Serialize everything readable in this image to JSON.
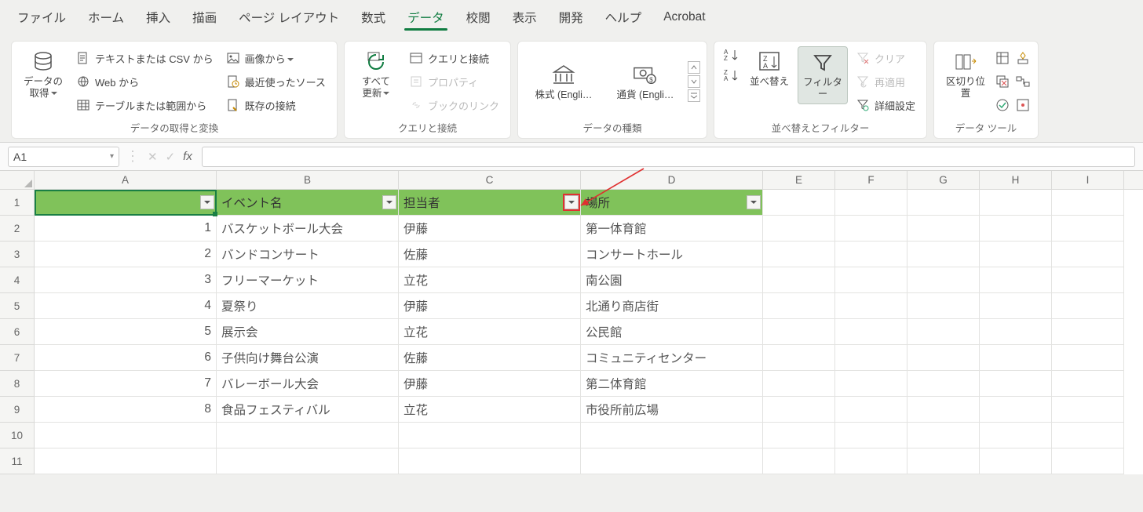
{
  "menu": [
    "ファイル",
    "ホーム",
    "挿入",
    "描画",
    "ページ レイアウト",
    "数式",
    "データ",
    "校閲",
    "表示",
    "開発",
    "ヘルプ",
    "Acrobat"
  ],
  "menu_active_index": 6,
  "ribbon": {
    "get_data": {
      "big": "データの\n取得",
      "items": [
        "テキストまたは CSV から",
        "Web から",
        "テーブルまたは範囲から"
      ],
      "col2": [
        "画像から",
        "最近使ったソース",
        "既存の接続"
      ],
      "label": "データの取得と変換"
    },
    "queries": {
      "big": "すべて\n更新",
      "items": [
        "クエリと接続",
        "プロパティ",
        "ブックのリンク"
      ],
      "label": "クエリと接続"
    },
    "datatypes": {
      "stock": "株式 (Engli…",
      "currency": "通貨 (Engli…",
      "label": "データの種類"
    },
    "sort": {
      "sort_btn": "並べ替え",
      "filter_btn": "フィルター",
      "clear": "クリア",
      "reapply": "再適用",
      "advanced": "詳細設定",
      "label": "並べ替えとフィルター"
    },
    "tools": {
      "t2c": "区切り位置",
      "label": "データ ツール"
    }
  },
  "namebox": "A1",
  "columns": [
    "A",
    "B",
    "C",
    "D",
    "E",
    "F",
    "G",
    "H",
    "I"
  ],
  "rows": [
    1,
    2,
    3,
    4,
    5,
    6,
    7,
    8,
    9,
    10,
    11
  ],
  "headers": {
    "A": "",
    "B": "イベント名",
    "C": "担当者",
    "D": "場所"
  },
  "data": [
    {
      "A": "1",
      "B": "バスケットボール大会",
      "C": "伊藤",
      "D": "第一体育館"
    },
    {
      "A": "2",
      "B": "バンドコンサート",
      "C": "佐藤",
      "D": "コンサートホール"
    },
    {
      "A": "3",
      "B": "フリーマーケット",
      "C": "立花",
      "D": "南公園"
    },
    {
      "A": "4",
      "B": "夏祭り",
      "C": "伊藤",
      "D": "北通り商店街"
    },
    {
      "A": "5",
      "B": "展示会",
      "C": "立花",
      "D": "公民館"
    },
    {
      "A": "6",
      "B": "子供向け舞台公演",
      "C": "佐藤",
      "D": "コミュニティセンター"
    },
    {
      "A": "7",
      "B": "バレーボール大会",
      "C": "伊藤",
      "D": "第二体育館"
    },
    {
      "A": "8",
      "B": "食品フェスティバル",
      "C": "立花",
      "D": "市役所前広場"
    }
  ]
}
